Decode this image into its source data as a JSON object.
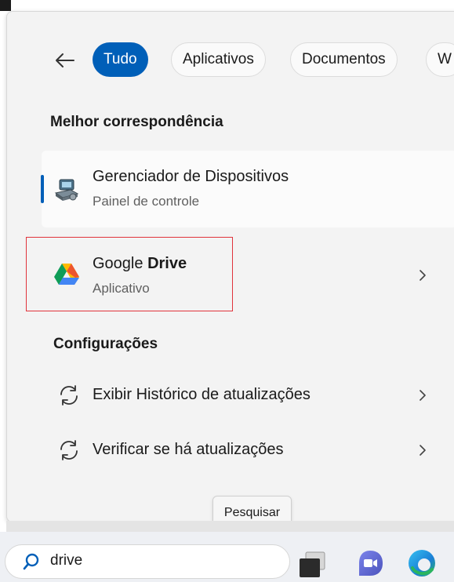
{
  "filters": {
    "back_label": "",
    "tabs": [
      {
        "label": "Tudo",
        "active": true
      },
      {
        "label": "Aplicativos",
        "active": false
      },
      {
        "label": "Documentos",
        "active": false
      },
      {
        "label": "W",
        "active": false
      }
    ]
  },
  "best_match": {
    "heading": "Melhor correspondência",
    "item": {
      "title": "Gerenciador de Dispositivos",
      "subtitle": "Painel de controle",
      "icon": "device-manager-icon"
    }
  },
  "app_result": {
    "title_prefix": "Google ",
    "title_match": "Drive",
    "subtitle": "Aplicativo",
    "icon": "google-drive-icon"
  },
  "settings": {
    "heading": "Configurações",
    "items": [
      {
        "label": "Exibir Histórico de atualizações",
        "icon": "sync-icon"
      },
      {
        "label": "Verificar se há atualizações",
        "icon": "sync-icon"
      }
    ]
  },
  "tooltip": {
    "text": "Pesquisar"
  },
  "taskbar": {
    "search_value": "drive",
    "icons": [
      "task-view-icon",
      "meet-icon",
      "edge-icon"
    ]
  },
  "colors": {
    "accent": "#005fb8",
    "highlight": "#e0333b"
  }
}
